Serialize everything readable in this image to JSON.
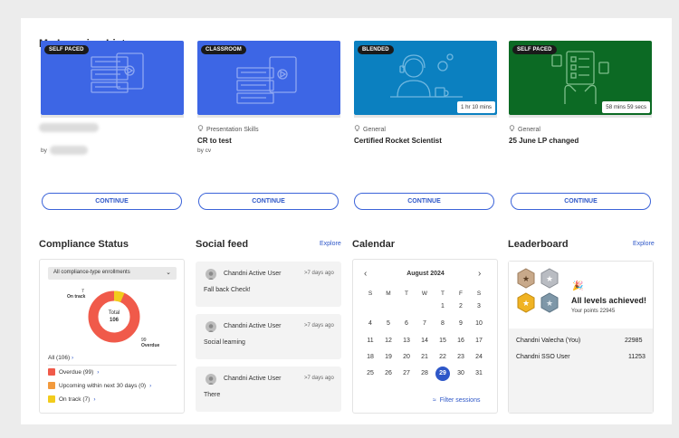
{
  "header": {
    "title": "My Learning List"
  },
  "cards": [
    {
      "badge": "SELF PACED",
      "color": "#3d66e5",
      "category": "",
      "title": "",
      "author": "by",
      "duration": "",
      "continue": "CONTINUE"
    },
    {
      "badge": "CLASSROOM",
      "color": "#3d66e5",
      "category": "Presentation Skills",
      "title": "CR to test",
      "author": "by cv",
      "duration": "",
      "continue": "CONTINUE"
    },
    {
      "badge": "BLENDED",
      "color": "#0b80c0",
      "category": "General",
      "title": "Certified Rocket Scientist",
      "author": "",
      "duration": "1 hr 10 mins",
      "continue": "CONTINUE"
    },
    {
      "badge": "SELF PACED",
      "color": "#0c6a24",
      "category": "General",
      "title": "25 June LP changed",
      "author": "",
      "duration": "58 mins 59 secs",
      "continue": "CONTINUE"
    }
  ],
  "compliance": {
    "title": "Compliance Status",
    "filter": "All compliance-type enrollments",
    "total_label": "Total",
    "total": "106",
    "on_track_value": "7",
    "on_track_label": "On track",
    "overdue_value": "99",
    "overdue_label": "Overdue",
    "all_link": "All (106)",
    "legend": [
      {
        "label": "Overdue (99)",
        "color": "#f05a4a"
      },
      {
        "label": "Upcoming within next 30 days (0)",
        "color": "#f29a3d"
      },
      {
        "label": "On track (7)",
        "color": "#f2cc1c"
      }
    ],
    "colors": {
      "overdue": "#f05a4a",
      "on_track": "#f2cc1c"
    }
  },
  "social": {
    "title": "Social feed",
    "explore": "Explore",
    "items": [
      {
        "name": "Chandni Active User",
        "time": ">7 days ago",
        "message": "Fall back Check!"
      },
      {
        "name": "Chandni Active User",
        "time": ">7 days ago",
        "message": "Social learning"
      },
      {
        "name": "Chandni Active User",
        "time": ">7 days ago",
        "message": "There"
      }
    ]
  },
  "calendar": {
    "title": "Calendar",
    "month": "August 2024",
    "weekdays": [
      "S",
      "M",
      "T",
      "W",
      "T",
      "F",
      "S"
    ],
    "weeks": [
      [
        "",
        "",
        "",
        "",
        "1",
        "2",
        "3"
      ],
      [
        "4",
        "5",
        "6",
        "7",
        "8",
        "9",
        "10"
      ],
      [
        "11",
        "12",
        "13",
        "14",
        "15",
        "16",
        "17"
      ],
      [
        "18",
        "19",
        "20",
        "21",
        "22",
        "23",
        "24"
      ],
      [
        "25",
        "26",
        "27",
        "28",
        "29",
        "30",
        "31"
      ]
    ],
    "selected": "29",
    "filter": "Filter sessions"
  },
  "leaderboard": {
    "title": "Leaderboard",
    "explore": "Explore",
    "achievement": "All levels achieved!",
    "points": "Your points 22945",
    "rows": [
      {
        "name": "Chandni Valecha (You)",
        "score": "22985"
      },
      {
        "name": "Chandni SSO User",
        "score": "11253"
      }
    ]
  }
}
